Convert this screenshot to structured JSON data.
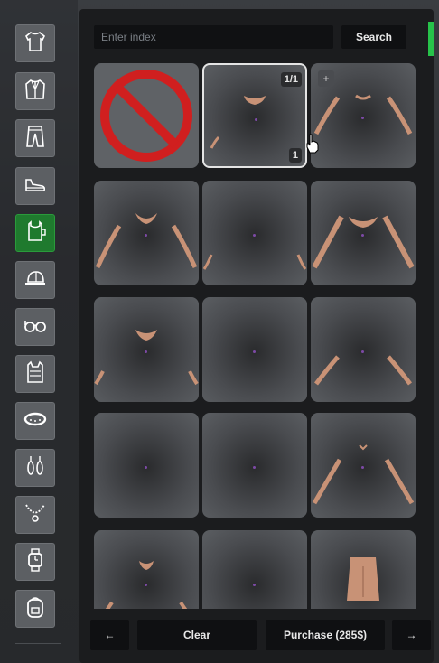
{
  "search": {
    "placeholder": "Enter index",
    "button_label": "Search"
  },
  "categories": [
    {
      "name": "shirt",
      "icon": "shirt-icon"
    },
    {
      "name": "jacket",
      "icon": "jacket-icon"
    },
    {
      "name": "pants",
      "icon": "pants-icon"
    },
    {
      "name": "shoes",
      "icon": "sneaker-icon"
    },
    {
      "name": "undershirt",
      "icon": "undershirt-icon",
      "active": true
    },
    {
      "name": "hat",
      "icon": "cap-icon"
    },
    {
      "name": "glasses",
      "icon": "glasses-icon"
    },
    {
      "name": "vest",
      "icon": "vest-icon"
    },
    {
      "name": "bracelet",
      "icon": "bracelet-icon"
    },
    {
      "name": "earrings",
      "icon": "earrings-icon"
    },
    {
      "name": "necklace",
      "icon": "necklace-icon"
    },
    {
      "name": "watch",
      "icon": "watch-icon"
    },
    {
      "name": "bag",
      "icon": "backpack-icon"
    }
  ],
  "grid": {
    "items": [
      {
        "type": "none"
      },
      {
        "type": "item",
        "selected": true,
        "variant_badge": "1/1",
        "count_badge": "1"
      },
      {
        "type": "item",
        "has_plus": true,
        "plus": "+"
      },
      {
        "type": "item"
      },
      {
        "type": "item"
      },
      {
        "type": "item"
      },
      {
        "type": "item"
      },
      {
        "type": "item"
      },
      {
        "type": "item"
      },
      {
        "type": "item"
      },
      {
        "type": "item"
      },
      {
        "type": "item"
      },
      {
        "type": "item"
      },
      {
        "type": "item"
      },
      {
        "type": "item"
      }
    ]
  },
  "footer": {
    "prev_label": "←",
    "clear_label": "Clear",
    "purchase_label": "Purchase (285$)",
    "next_label": "→"
  },
  "colors": {
    "accent": "#27c24a",
    "active_category": "#1f7a2e",
    "forbidden_red": "#d01f1f"
  }
}
